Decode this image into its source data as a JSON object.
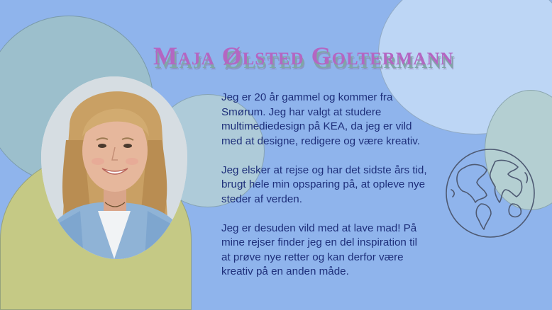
{
  "slide": {
    "title": "Maja Ølsted Goltermann",
    "paragraphs": [
      "Jeg er 20 år gammel og kommer fra\nSmørum. Jeg har valgt at studere\nmultimediedesign på KEA, da jeg er vild\nmed at designe, redigere og være kreativ.",
      "Jeg elsker at rejse og har det sidste års tid,\nbrugt hele min opsparing på, at opleve nye\nsteder af verden.",
      "Jeg er desuden vild med at lave mad! På\nmine rejser finder jeg en del inspiration til\nat prøve nye retter og kan derfor være\nkreativ på en anden måde."
    ]
  },
  "icons": {
    "globe": "globe-icon"
  },
  "colors": {
    "background": "#8fb4ec",
    "title": "#b466c2",
    "title_shadow": "#7fa6a6",
    "body_text": "#1e2f7a",
    "circle_teal": "#9cbfcc",
    "circle_olive": "#c5c985",
    "circle_light_blue": "#bdd6f5"
  }
}
